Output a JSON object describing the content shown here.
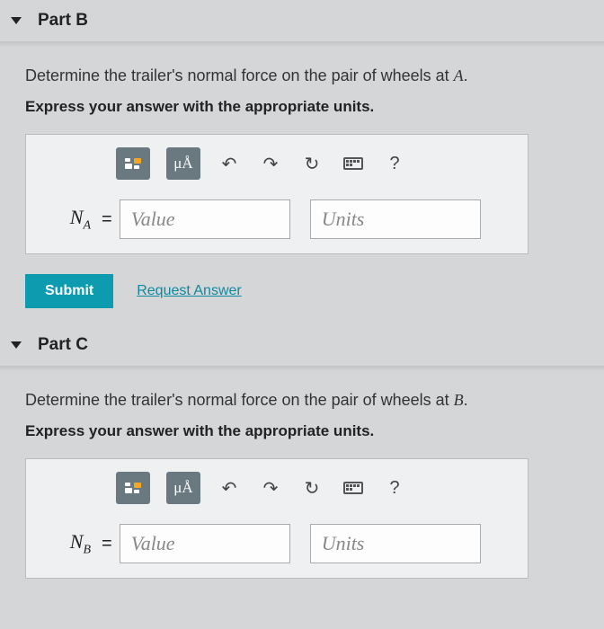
{
  "partB": {
    "title": "Part B",
    "prompt_prefix": "Determine the trailer's normal force on the pair of wheels at ",
    "prompt_var": "A",
    "prompt_suffix": ".",
    "instruction": "Express your answer with the appropriate units.",
    "toolbar": {
      "mua_label": "μÅ",
      "help_label": "?"
    },
    "var_symbol": "N",
    "var_sub": "A",
    "eq": "=",
    "value_placeholder": "Value",
    "units_placeholder": "Units",
    "submit_label": "Submit",
    "request_label": "Request Answer"
  },
  "partC": {
    "title": "Part C",
    "prompt_prefix": "Determine the trailer's normal force on the pair of wheels at ",
    "prompt_var": "B",
    "prompt_suffix": ".",
    "instruction": "Express your answer with the appropriate units.",
    "toolbar": {
      "mua_label": "μÅ",
      "help_label": "?"
    },
    "var_symbol": "N",
    "var_sub": "B",
    "eq": "=",
    "value_placeholder": "Value",
    "units_placeholder": "Units"
  }
}
